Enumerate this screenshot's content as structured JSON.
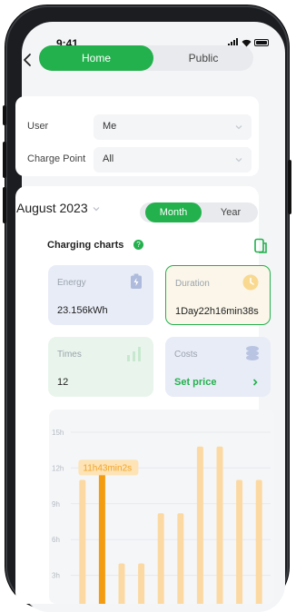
{
  "status_bar": {
    "time": "9:41"
  },
  "nav": {
    "tabs": [
      {
        "label": "Home",
        "active": true
      },
      {
        "label": "Public",
        "active": false
      }
    ]
  },
  "filters": {
    "user": {
      "label": "User",
      "value": "Me"
    },
    "charge_point": {
      "label": "Charge Point",
      "value": "All"
    }
  },
  "period": {
    "month_label": "August 2023",
    "toggle": [
      {
        "label": "Month",
        "active": true
      },
      {
        "label": "Year",
        "active": false
      }
    ]
  },
  "charts_title": "Charging charts",
  "stats": {
    "energy": {
      "label": "Energy",
      "value": "23.156kWh",
      "icon": "battery-icon"
    },
    "duration": {
      "label": "Duration",
      "value": "1Day22h16min38s",
      "icon": "clock-icon"
    },
    "times": {
      "label": "Times",
      "value": "12",
      "icon": "bar-chart-icon"
    },
    "costs": {
      "label": "Costs",
      "value": "Set price",
      "icon": "coins-icon"
    }
  },
  "colors": {
    "accent": "#23b14d",
    "bar": "#fcd9a2",
    "bar_highlight": "#f39c11"
  },
  "chart_data": {
    "type": "bar",
    "y_ticks": [
      "15h",
      "12h",
      "9h",
      "6h",
      "3h"
    ],
    "ylim": [
      0,
      15
    ],
    "grid": true,
    "tooltip": "11h43min2s",
    "highlight_index": 1,
    "values": [
      11,
      11.7,
      4,
      4,
      8.2,
      8.2,
      13.8,
      13.8,
      11,
      11
    ]
  }
}
